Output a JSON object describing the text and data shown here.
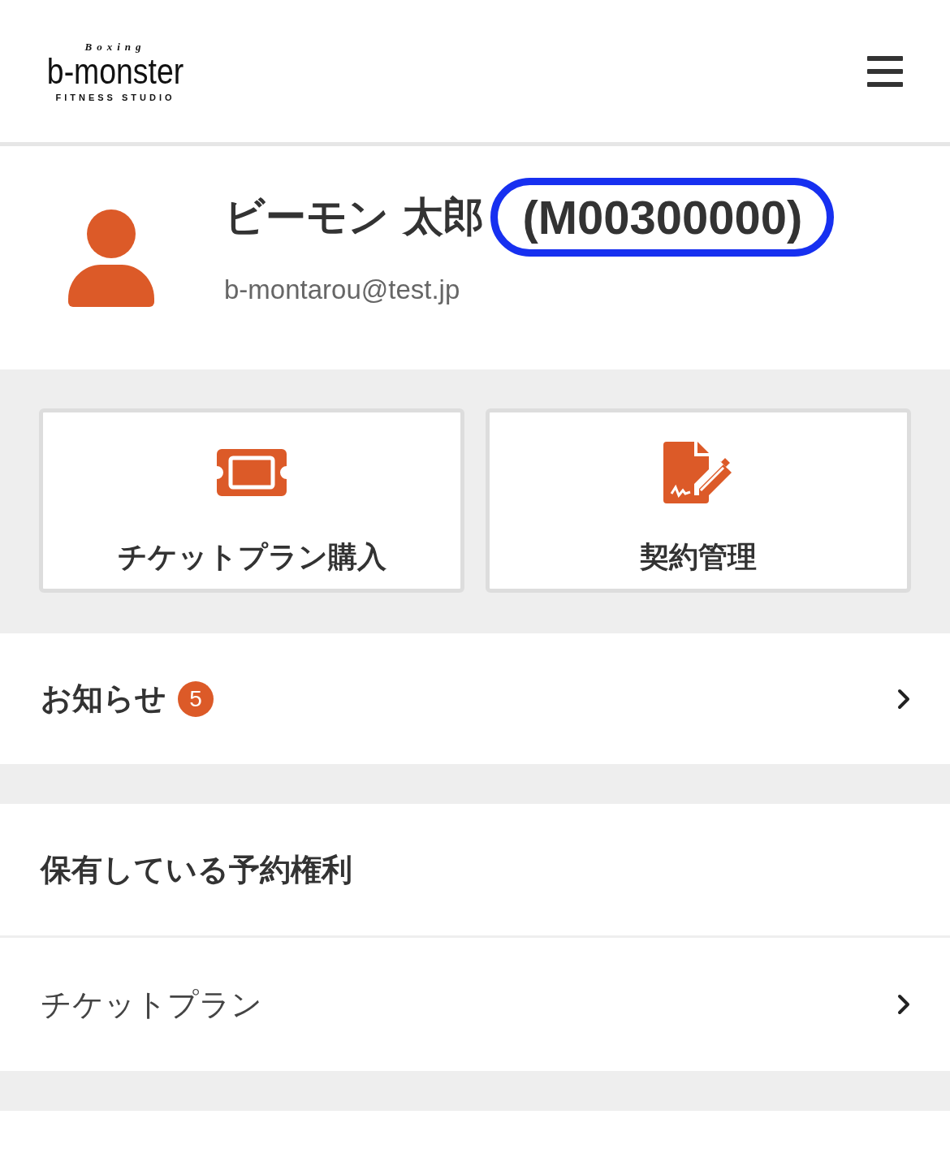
{
  "header": {
    "logo": {
      "top": "Boxing",
      "main": "b-monster",
      "sub": "FITNESS STUDIO"
    }
  },
  "profile": {
    "name": "ビーモン 太郎",
    "member_id": "(M00300000)",
    "member_id_highlighted": true,
    "email": "b-montarou@test.jp"
  },
  "actions": [
    {
      "kind": "ticket",
      "label": "チケットプラン購入"
    },
    {
      "kind": "contract",
      "label": "契約管理"
    }
  ],
  "notices": {
    "label": "お知らせ",
    "badge": "5"
  },
  "reservations": {
    "title": "保有している予約権利",
    "items": [
      {
        "label": "チケットプラン"
      }
    ]
  }
}
